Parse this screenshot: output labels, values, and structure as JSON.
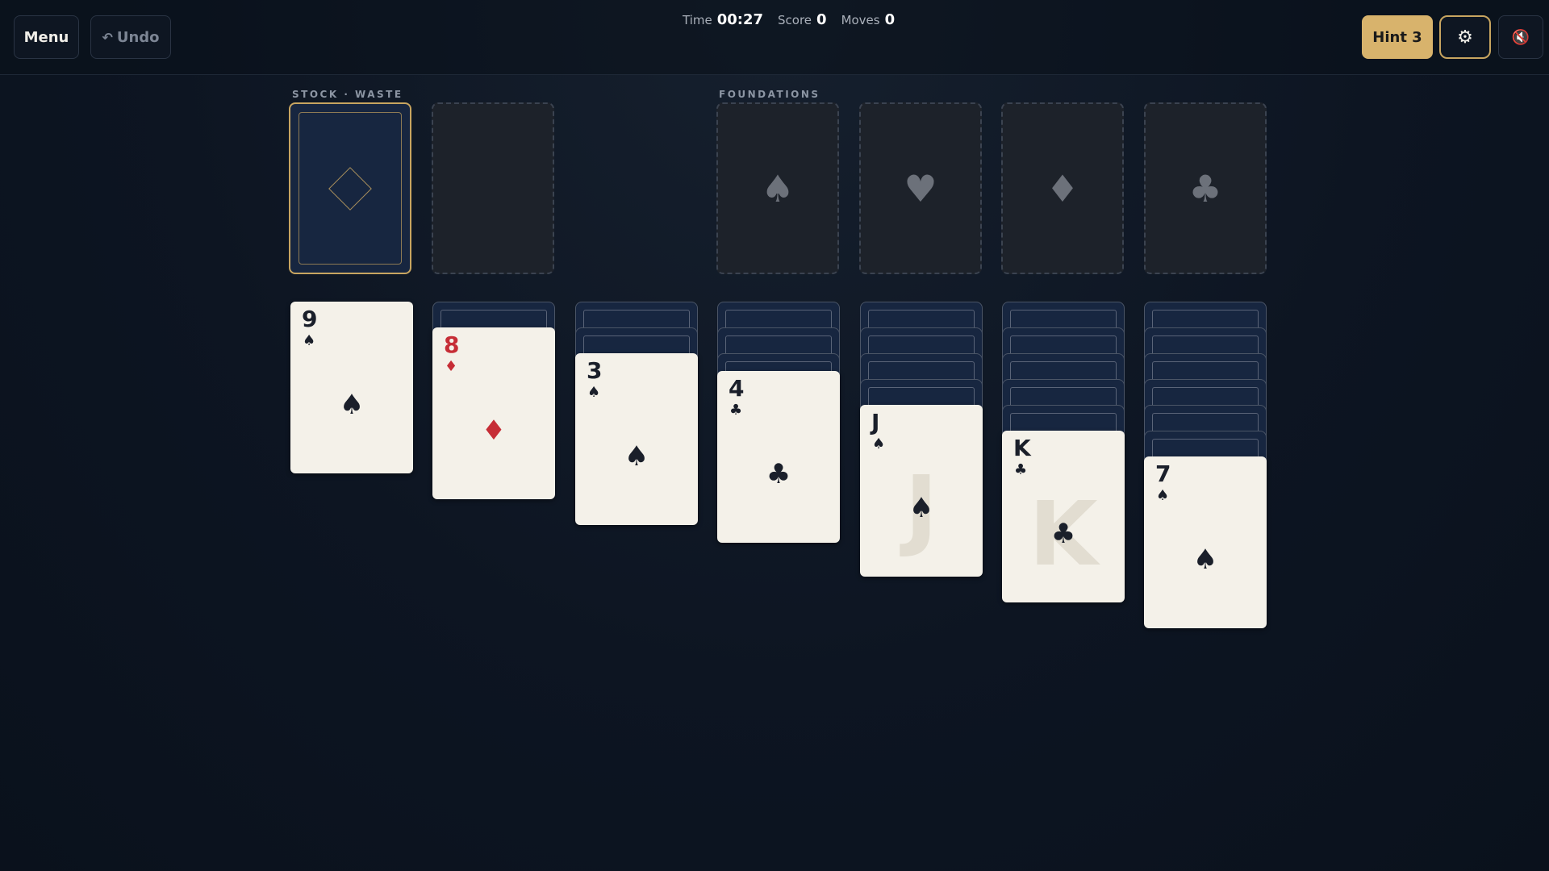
{
  "toolbar": {
    "menu_label": "Menu",
    "undo_label": "Undo",
    "undo_icon": "↶",
    "hint_label": "Hint 3",
    "settings_icon": "⚙",
    "mute_icon": "🔇"
  },
  "stats": {
    "time_label": "Time",
    "time_value": "00:27",
    "score_label": "Score",
    "score_value": "0",
    "moves_label": "Moves",
    "moves_value": "0"
  },
  "labels": {
    "stock_waste": "STOCK · WASTE",
    "foundations": "FOUNDATIONS"
  },
  "foundations": [
    {
      "suit": "♠"
    },
    {
      "suit": "♥"
    },
    {
      "suit": "♦"
    },
    {
      "suit": "♣"
    }
  ],
  "tableau": [
    {
      "face_down": 0,
      "rank": "9",
      "suit": "♠",
      "color": "black"
    },
    {
      "face_down": 1,
      "rank": "8",
      "suit": "♦",
      "color": "red"
    },
    {
      "face_down": 2,
      "rank": "3",
      "suit": "♠",
      "color": "black"
    },
    {
      "face_down": 3,
      "rank": "4",
      "suit": "♣",
      "color": "black"
    },
    {
      "face_down": 4,
      "rank": "J",
      "suit": "♠",
      "color": "black"
    },
    {
      "face_down": 5,
      "rank": "K",
      "suit": "♣",
      "color": "black"
    },
    {
      "face_down": 6,
      "rank": "7",
      "suit": "♠",
      "color": "black"
    }
  ],
  "colors": {
    "red_suit": "#c62d36",
    "black_suit": "#1a1f2a",
    "card_back": "#172640",
    "accent_gold": "#d8b36c"
  }
}
